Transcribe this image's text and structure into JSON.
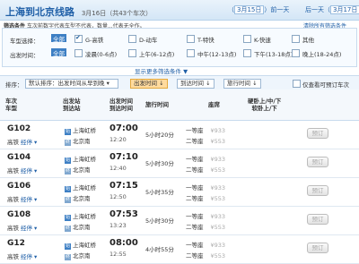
{
  "header": {
    "title": "上海到北京线路",
    "date_info": "3月16日（共43个车次）",
    "prev_label": "（",
    "prev_date": "3月15日",
    "prev_tail": "）前一天",
    "next_label": "后一天（",
    "next_date": "3月17日",
    "next_tail": "）"
  },
  "hint": {
    "key": "筛选条件",
    "text": "车次前数字代表车型不代表，数量...代表无全作。",
    "clear_link": "清除所有筛选条件"
  },
  "filters": {
    "train_type": {
      "label": "车型选择：",
      "all": "全部",
      "options": [
        {
          "label": "G-高铁",
          "checked": true
        },
        {
          "label": "D-动车",
          "checked": false
        },
        {
          "label": "T-特快",
          "checked": false
        },
        {
          "label": "K-快速",
          "checked": false
        },
        {
          "label": "其他",
          "checked": false
        }
      ]
    },
    "depart_time": {
      "label": "出发时间：",
      "all": "全部",
      "options": [
        {
          "label": "凌晨(0-6点)",
          "checked": false
        },
        {
          "label": "上午(6-12点)",
          "checked": false
        },
        {
          "label": "中午(12-13点)",
          "checked": false
        },
        {
          "label": "下午(13-18点)",
          "checked": false
        },
        {
          "label": "晚上(18-24点)",
          "checked": false
        }
      ]
    },
    "more_link": "显示更多筛选条件"
  },
  "sortbar": {
    "label": "排序：",
    "select_value": "默认排序：出发时间从早到晚",
    "btn_depart": "出发时间",
    "btn_arrive": "到达时间",
    "btn_duration": "旅行时间",
    "show_bookable": "仅查看可预订车次"
  },
  "table": {
    "headers": {
      "train": "车次\n车型",
      "station": "出发站\n到达站",
      "time": "出发时间\n到达时间",
      "duration": "旅行时间",
      "seat": "座席",
      "price": "硬卧上/中/下\n软卧上/下",
      "book": ""
    },
    "rows": [
      {
        "no": "G102",
        "type": "高铁",
        "stop": "经停",
        "from": "上海虹桥",
        "to": "北京南",
        "dep": "07:00",
        "arr": "12:20",
        "duration": "5小时20分",
        "seat1": "一等座",
        "price1": "¥933",
        "seat2": "二等座",
        "price2": "¥553",
        "book": "预订"
      },
      {
        "no": "G104",
        "type": "高铁",
        "stop": "经停",
        "from": "上海虹桥",
        "to": "北京南",
        "dep": "07:10",
        "arr": "12:40",
        "duration": "5小时30分",
        "seat1": "一等座",
        "price1": "¥933",
        "seat2": "二等座",
        "price2": "¥553",
        "book": "预订"
      },
      {
        "no": "G106",
        "type": "高铁",
        "stop": "经停",
        "from": "上海虹桥",
        "to": "北京南",
        "dep": "07:15",
        "arr": "12:50",
        "duration": "5小时35分",
        "seat1": "一等座",
        "price1": "¥933",
        "seat2": "二等座",
        "price2": "¥553",
        "book": "预订"
      },
      {
        "no": "G108",
        "type": "高铁",
        "stop": "经停",
        "from": "上海虹桥",
        "to": "北京南",
        "dep": "07:53",
        "arr": "13:23",
        "duration": "5小时30分",
        "seat1": "一等座",
        "price1": "¥933",
        "seat2": "二等座",
        "price2": "¥553",
        "book": "预订"
      },
      {
        "no": "G12",
        "type": "高铁",
        "stop": "经停",
        "from": "上海虹桥",
        "to": "北京南",
        "dep": "08:00",
        "arr": "12:55",
        "duration": "4小时55分",
        "seat1": "一等座",
        "price1": "¥933",
        "seat2": "二等座",
        "price2": "¥553",
        "book": "预订"
      }
    ]
  },
  "colors": {
    "accent": "#1f5fa7",
    "active_sort": "#ffdb9e",
    "header_bg": "#d4e6f6"
  }
}
